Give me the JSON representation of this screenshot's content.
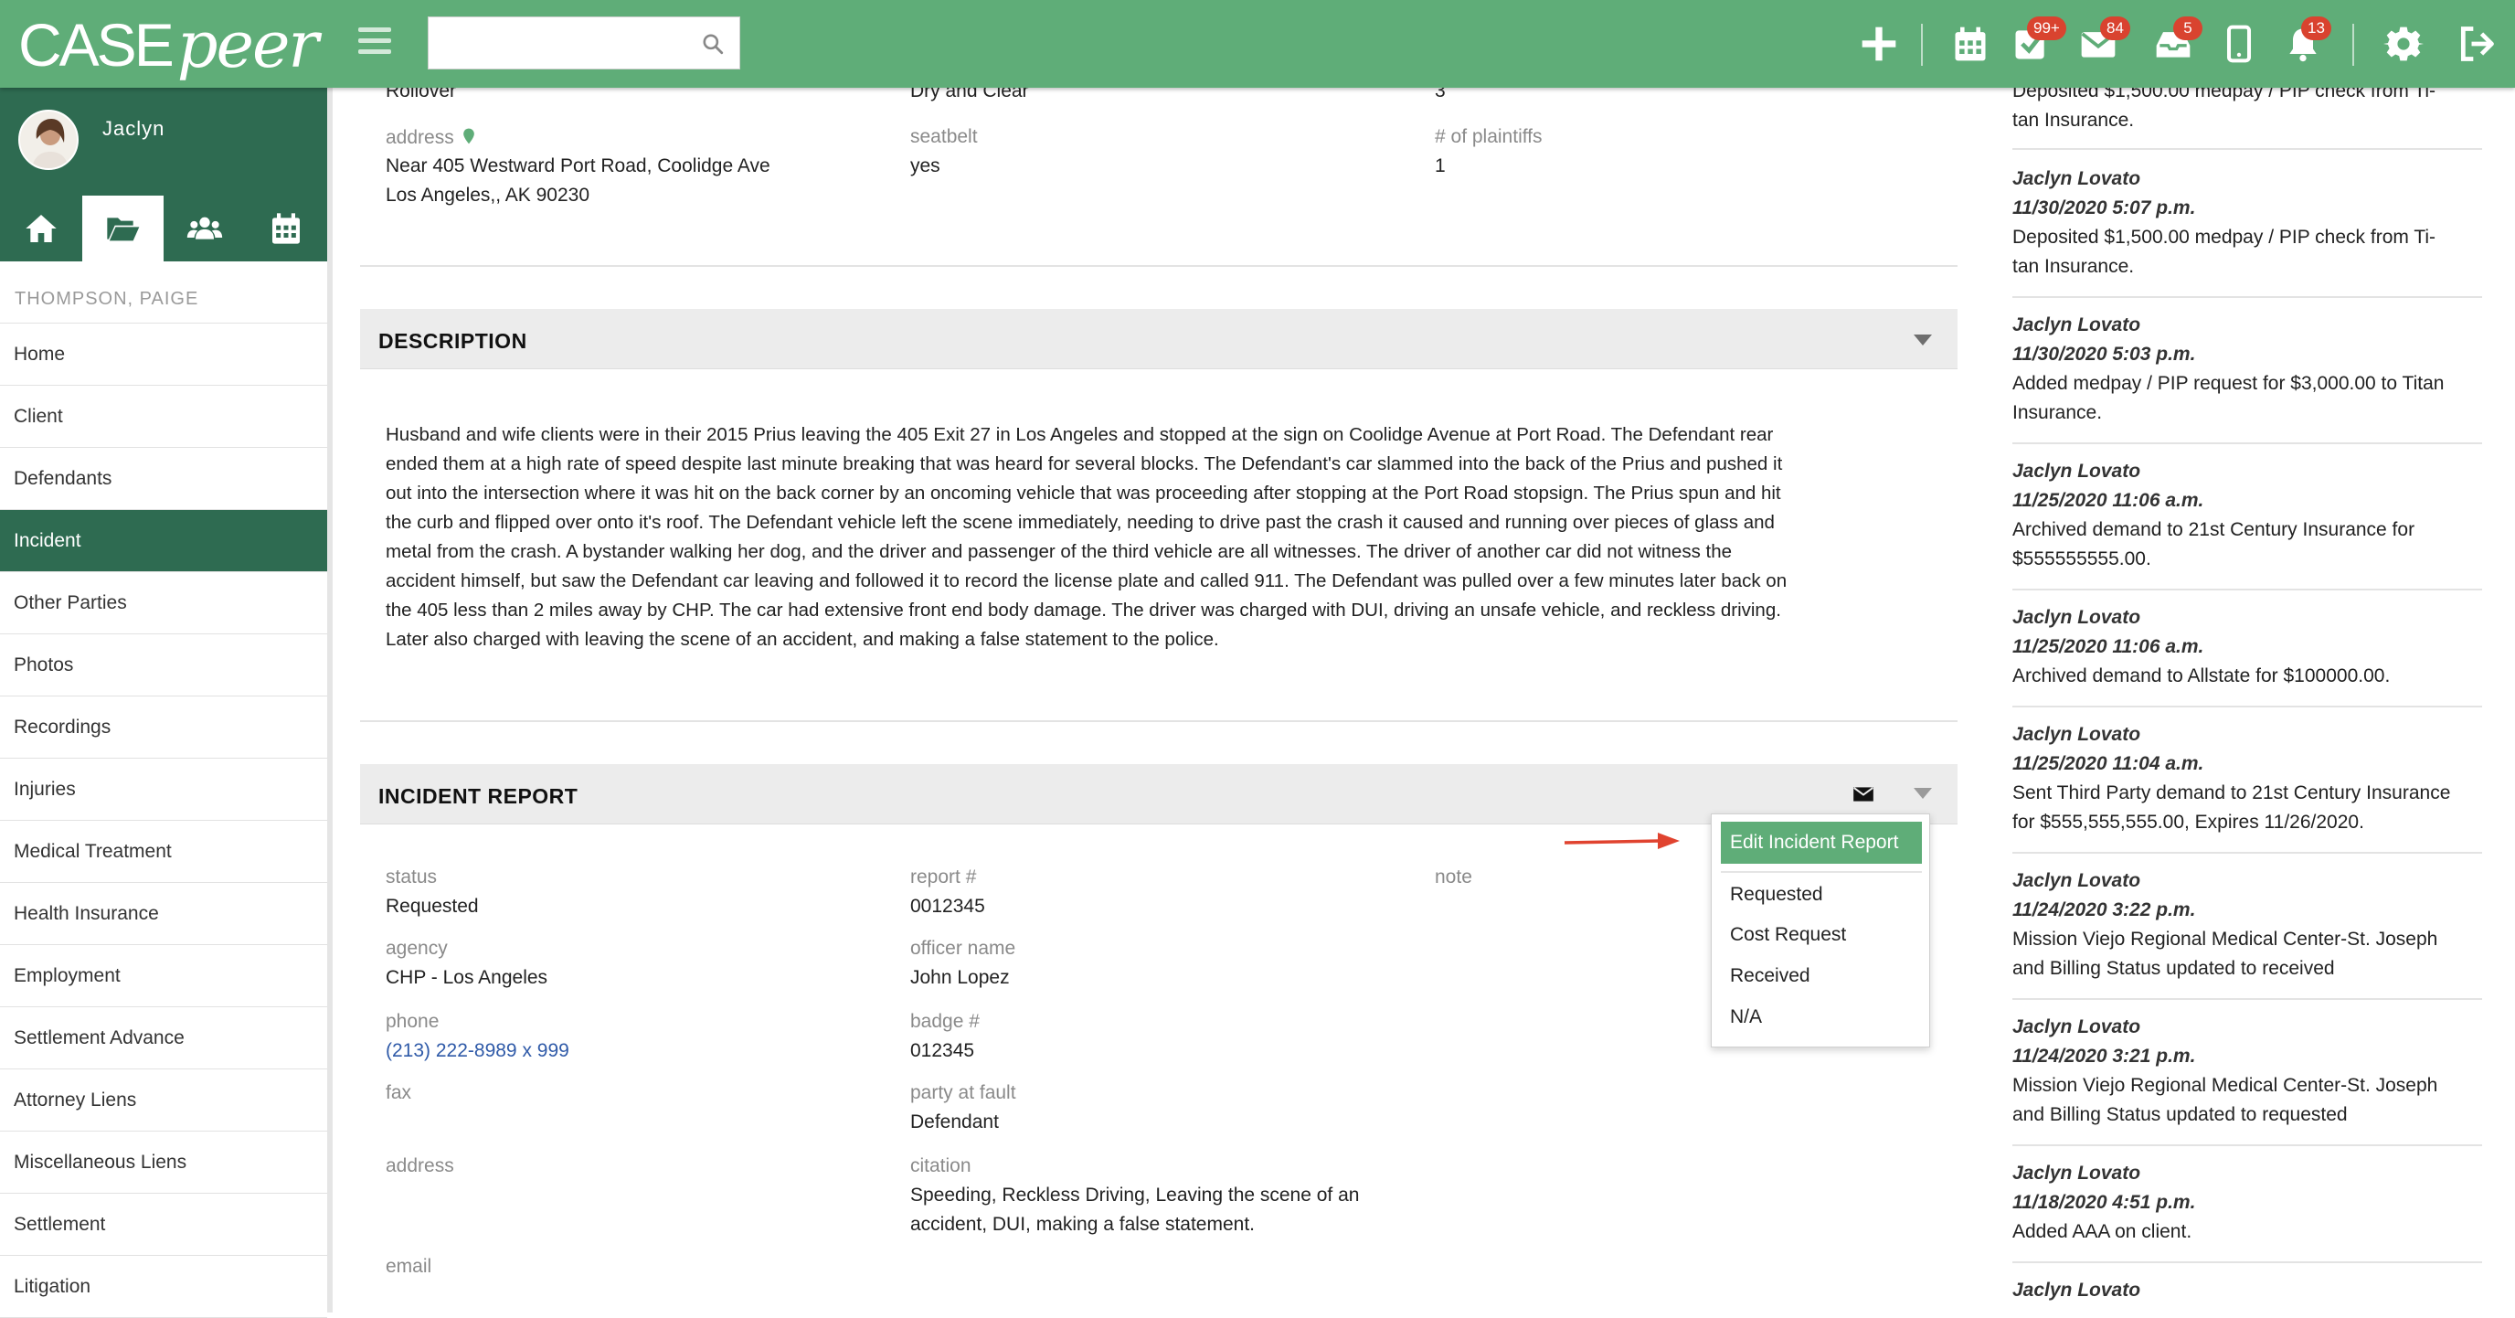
{
  "app": {
    "logo_case": "CASE",
    "logo_peer": "peer",
    "search_placeholder": "",
    "badges": {
      "tasks": "99+",
      "mail": "84",
      "inbox": "5",
      "notifications": "13"
    }
  },
  "sidebar": {
    "user": "Jaclyn",
    "client": "THOMPSON, PAIGE",
    "items": [
      {
        "label": "Home"
      },
      {
        "label": "Client"
      },
      {
        "label": "Defendants"
      },
      {
        "label": "Incident",
        "active": true
      },
      {
        "label": "Other Parties"
      },
      {
        "label": "Photos"
      },
      {
        "label": "Recordings"
      },
      {
        "label": "Injuries"
      },
      {
        "label": "Medical Treatment"
      },
      {
        "label": "Health Insurance"
      },
      {
        "label": "Employment"
      },
      {
        "label": "Settlement Advance"
      },
      {
        "label": "Attorney Liens"
      },
      {
        "label": "Miscellaneous Liens"
      },
      {
        "label": "Settlement"
      },
      {
        "label": "Litigation"
      }
    ]
  },
  "incident": {
    "crash_type": "Rollover",
    "road_conditions": "Dry and Clear",
    "vehicles": "3",
    "address_label": "address",
    "address_line1": "Near 405 Westward Port Road, Coolidge Ave",
    "address_line2": "Los Angeles,, AK 90230",
    "seatbelt_label": "seatbelt",
    "seatbelt": "yes",
    "plaintiffs_label": "# of plaintiffs",
    "plaintiffs": "1"
  },
  "description": {
    "title": "DESCRIPTION",
    "lines": [
      "Husband and wife clients were in their 2015 Prius leaving the 405 Exit 27 in Los Angeles and stopped at the sign on Coolidge Avenue at Port Road. The Defendant rear",
      "ended them at a high rate of speed despite last minute breaking that was heard for several blocks.  The Defendant's car slammed into the back of the Prius and pushed it",
      "out into the intersection where it was hit on the back corner by an oncoming vehicle that was proceeding after stopping at the Port Road stopsign.  The Prius spun and hit",
      "the curb and flipped over onto it's roof. The Defendant vehicle left the scene immediately, needing to drive past the crash it caused and running over pieces of glass and",
      "metal from the crash.  A bystander walking her dog, and the driver and passenger of the third vehicle are all witnesses.  The driver of another car did not witness the",
      "accident himself, but saw the Defendant car leaving and followed it to record the license plate and called 911.  The Defendant was pulled over a few minutes later back on",
      "the 405 less than 2 miles away by CHP. The car had extensive front end body damage. The driver was charged with DUI, driving an unsafe vehicle, and reckless driving.",
      "Later also charged with leaving the scene of an accident, and making a false statement to the police."
    ]
  },
  "report": {
    "title": "INCIDENT REPORT",
    "status_label": "status",
    "status": "Requested",
    "agency_label": "agency",
    "agency": "CHP - Los Angeles",
    "phone_label": "phone",
    "phone": "(213) 222-8989 x 999",
    "fax_label": "fax",
    "address_label": "address",
    "email_label": "email",
    "report_no_label": "report #",
    "report_no": "0012345",
    "officer_label": "officer name",
    "officer": "John Lopez",
    "badge_label": "badge #",
    "badge": "012345",
    "fault_label": "party at fault",
    "fault": "Defendant",
    "citation_label": "citation",
    "citation_line1": "Speeding, Reckless Driving, Leaving the scene of an",
    "citation_line2": "accident, DUI, making a false statement.",
    "note_label": "note",
    "menu": {
      "edit": "Edit Incident Report",
      "options": [
        "Requested",
        "Cost Request",
        "Received",
        "N/A"
      ]
    }
  },
  "activity": [
    {
      "author": "",
      "stamp": "",
      "msg1": "Deposited $1,500.00 medpay / PIP check from Ti-",
      "msg2": "tan Insurance."
    },
    {
      "author": "Jaclyn Lovato",
      "stamp": "11/30/2020 5:07 p.m.",
      "msg1": "Deposited $1,500.00 medpay / PIP check from Ti-",
      "msg2": "tan Insurance."
    },
    {
      "author": "Jaclyn Lovato",
      "stamp": "11/30/2020 5:03 p.m.",
      "msg1": "Added medpay / PIP request for $3,000.00 to Titan",
      "msg2": "Insurance."
    },
    {
      "author": "Jaclyn Lovato",
      "stamp": "11/25/2020 11:06 a.m.",
      "msg1": "Archived demand to 21st Century Insurance for",
      "msg2": "$555555555.00."
    },
    {
      "author": "Jaclyn Lovato",
      "stamp": "11/25/2020 11:06 a.m.",
      "msg1": "Archived demand to Allstate for $100000.00.",
      "msg2": ""
    },
    {
      "author": "Jaclyn Lovato",
      "stamp": "11/25/2020 11:04 a.m.",
      "msg1": "Sent Third Party demand to 21st Century Insurance",
      "msg2": "for $555,555,555.00, Expires 11/26/2020."
    },
    {
      "author": "Jaclyn Lovato",
      "stamp": "11/24/2020 3:22 p.m.",
      "msg1": "Mission Viejo Regional Medical Center-St. Joseph",
      "msg2": "and Billing Status updated to received"
    },
    {
      "author": "Jaclyn Lovato",
      "stamp": "11/24/2020 3:21 p.m.",
      "msg1": "Mission Viejo Regional Medical Center-St. Joseph",
      "msg2": "and Billing Status updated to requested"
    },
    {
      "author": "Jaclyn Lovato",
      "stamp": "11/18/2020 4:51 p.m.",
      "msg1": "Added AAA on client.",
      "msg2": ""
    },
    {
      "author": "Jaclyn Lovato",
      "stamp": "",
      "msg1": "",
      "msg2": ""
    }
  ],
  "colors": {
    "brand_green": "#5fad78",
    "dark_green": "#2e6b51",
    "badge_red": "#d9432f",
    "arrow_red": "#e0432f"
  }
}
